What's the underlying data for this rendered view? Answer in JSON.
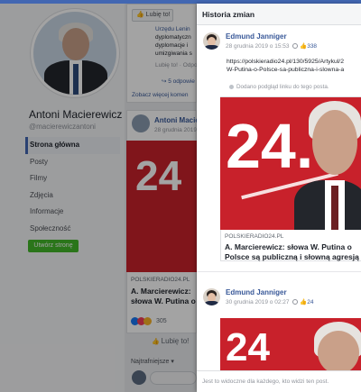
{
  "profile": {
    "name": "Antoni Macierewicz",
    "handle": "@macierewiczantoni",
    "nav": [
      "Strona główna",
      "Posty",
      "Filmy",
      "Zdjęcia",
      "Informacje",
      "Społeczność"
    ],
    "create_page": "Utwórz stronę"
  },
  "feed": {
    "like_top": "Lubię to!",
    "snippet_lines": [
      "Urzędu Lenin",
      "dyplomatyczn",
      "dyplomacje i",
      "umizgiwania s"
    ],
    "reply_line": "Lubię to! · Odpo",
    "replies": "5 odpowie",
    "more_comments": "Zobacz więcej komen",
    "post_author": "Antoni Macie",
    "post_date": "28 grudnia 2019",
    "post_domain": "POLSKIERADIO24.PL",
    "post_title": "A. Marcierewicz: słowa W. Putina o Polsce są publiczną i słowną agresją",
    "reactions_count": "305",
    "like_button": "Lubię to!",
    "sort_label": "Najtrafniejsze ▾"
  },
  "modal": {
    "title": "Historia zmian",
    "entries": [
      {
        "author": "Edmund Janniger",
        "date": "28 grudnia 2019 o 15:53",
        "likes": "338",
        "url_line1": "https://polskieradio24.pl/130/5925/Artykul/2",
        "url_line2": "W-Putina-o-Polsce-sa-publiczna-i-slowna-a",
        "note": "Dodano podgląd linku do tego posta.",
        "link_image_text": "24.",
        "link_domain": "POLSKIERADIO24.PL",
        "link_title": "A. Marcierewicz: słowa W. Putina o Polsce są publiczną i słowną agresją"
      },
      {
        "author": "Edmund Janniger",
        "date": "30 grudnia 2019 o 02:27",
        "likes": "24"
      }
    ],
    "footer": "Jest to widoczne dla każdego, kto widzi ten post."
  },
  "colors": {
    "facebook_blue": "#4267b2",
    "link_blue": "#385898",
    "brand_red": "#c8212b",
    "create_green": "#42b72a"
  }
}
